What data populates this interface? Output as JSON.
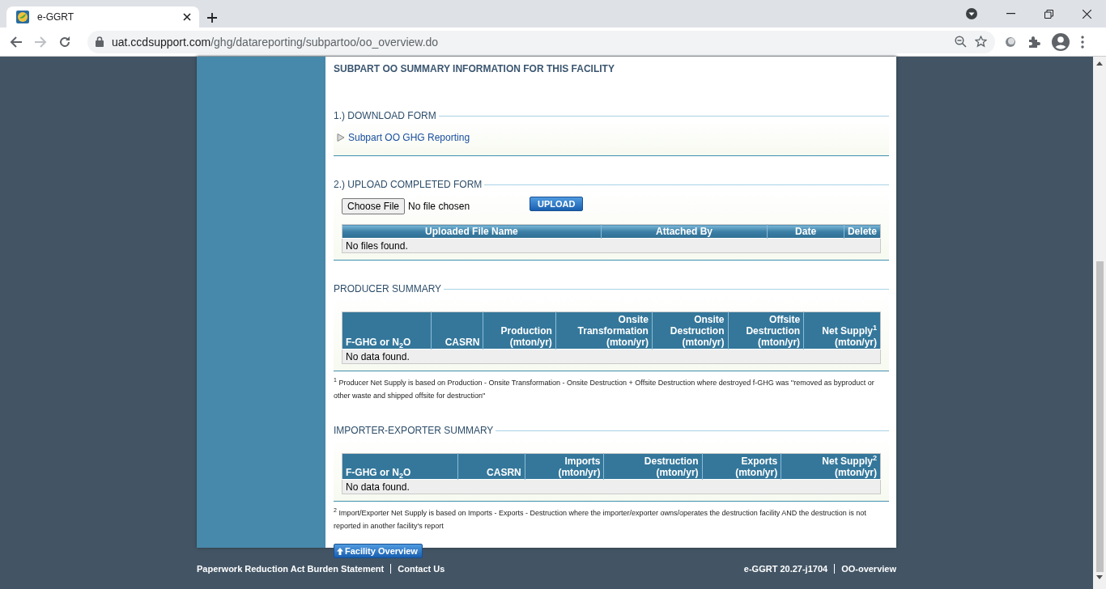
{
  "browser": {
    "tab": {
      "title": "e-GGRT",
      "selected": true
    },
    "url": {
      "host": "uat.ccdsupport.com",
      "path": "/ghg/datareporting/subpartoo/oo_overview.do"
    }
  },
  "page": {
    "heading": "SUBPART OO SUMMARY INFORMATION FOR THIS FACILITY",
    "sections": [
      {
        "kind": "download",
        "legend": "1.) DOWNLOAD FORM",
        "link": "Subpart OO GHG Reporting"
      },
      {
        "kind": "upload",
        "legend": "2.) UPLOAD COMPLETED FORM",
        "file_button": "Choose File",
        "file_status": "No file chosen",
        "upload_button": "UPLOAD",
        "table": {
          "columns": [
            {
              "lines": [
                "Uploaded File Name"
              ]
            },
            {
              "lines": [
                "Attached By"
              ]
            },
            {
              "lines": [
                "Date"
              ]
            },
            {
              "lines": [
                "Delete"
              ]
            }
          ],
          "empty": "No files found."
        }
      },
      {
        "kind": "summary",
        "legend": "PRODUCER SUMMARY",
        "table": {
          "columns": [
            {
              "lines": [
                "F-GHG or N$_{2}$O"
              ]
            },
            {
              "lines": [
                "CASRN"
              ]
            },
            {
              "lines": [
                "Production",
                "(mton/yr)"
              ]
            },
            {
              "lines": [
                "Onsite",
                "Transformation",
                "(mton/yr)"
              ]
            },
            {
              "lines": [
                "Onsite",
                "Destruction",
                "(mton/yr)"
              ]
            },
            {
              "lines": [
                "Offsite",
                "Destruction",
                "(mton/yr)"
              ]
            },
            {
              "lines": [
                "Net Supply$^{1}$",
                "(mton/yr)"
              ]
            }
          ],
          "empty": "No data found."
        },
        "footnote": "$^{1}$ Producer Net Supply is based on Production - Onsite Transformation - Onsite Destruction + Offsite Destruction where destroyed f-GHG was ''removed as byproduct or other waste and shipped offsite for destruction''"
      },
      {
        "kind": "summary",
        "legend": "IMPORTER-EXPORTER SUMMARY",
        "table": {
          "columns": [
            {
              "lines": [
                "F-GHG or N$_{2}$O"
              ]
            },
            {
              "lines": [
                "CASRN"
              ]
            },
            {
              "lines": [
                "Imports",
                "(mton/yr)"
              ]
            },
            {
              "lines": [
                "Destruction",
                "(mton/yr)"
              ]
            },
            {
              "lines": [
                "Exports",
                "(mton/yr)"
              ]
            },
            {
              "lines": [
                "Net Supply$^{2}$",
                "(mton/yr)"
              ]
            }
          ],
          "empty": "No data found."
        },
        "footnote": "$^{2}$ Import/Exporter Net Supply is based on Imports - Exports - Destruction where the importer/exporter owns/operates the destruction facility AND the destruction is not reported in another facility's report"
      }
    ],
    "back_button": "Facility Overview"
  },
  "footer": {
    "left_links": [
      "Paperwork Reduction Act Burden Statement",
      "Contact Us"
    ],
    "right_items": [
      "e-GGRT 20.27-j1704",
      "OO-overview"
    ]
  }
}
